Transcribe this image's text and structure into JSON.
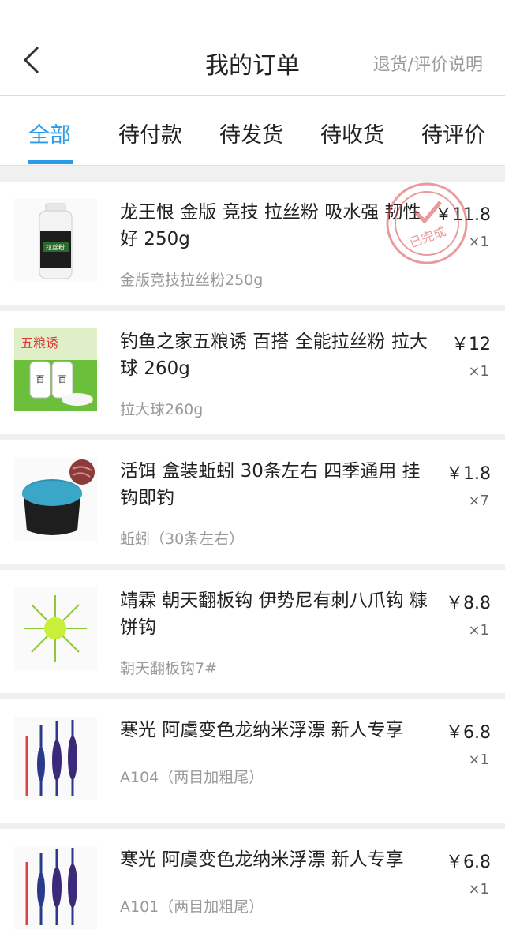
{
  "header": {
    "back_icon": "chevron-left-icon",
    "title": "我的订单",
    "help_link": "退货/评价说明"
  },
  "tabs": [
    {
      "label": "全部",
      "active": true
    },
    {
      "label": "待付款",
      "active": false
    },
    {
      "label": "待发货",
      "active": false
    },
    {
      "label": "待收货",
      "active": false
    },
    {
      "label": "待评价",
      "active": false
    }
  ],
  "accent_color": "#2a9be6",
  "orders": [
    {
      "name": "龙王恨 金版 竞技 拉丝粉 吸水强 韧性好 250g",
      "spec": "金版竞技拉丝粉250g",
      "price": "￥11.8",
      "qty": "×1",
      "stamp_text": "已完成",
      "thumb": "bottle-icon"
    },
    {
      "name": "钓鱼之家五粮诱 百搭 全能拉丝粉 拉大球 260g",
      "spec": "拉大球260g",
      "price": "￥12",
      "qty": "×1",
      "thumb": "bait-jar-icon"
    },
    {
      "name": "活饵 盒装蚯蚓 30条左右 四季通用 挂钩即钓",
      "spec": "蚯蚓（30条左右）",
      "price": "￥1.8",
      "qty": "×7",
      "thumb": "worm-box-icon"
    },
    {
      "name": "靖霖 朝天翻板钩 伊势尼有刺八爪钩 糠饼钩",
      "spec": "朝天翻板钩7#",
      "price": "￥8.8",
      "qty": "×1",
      "thumb": "hook-icon"
    },
    {
      "name": "寒光 阿虞变色龙纳米浮漂 新人专享",
      "spec": "A104（两目加粗尾）",
      "price": "￥6.8",
      "qty": "×1",
      "thumb": "float-icon"
    },
    {
      "name": "寒光 阿虞变色龙纳米浮漂 新人专享",
      "spec": "A101（两目加粗尾）",
      "price": "￥6.8",
      "qty": "×1",
      "thumb": "float-icon"
    }
  ]
}
